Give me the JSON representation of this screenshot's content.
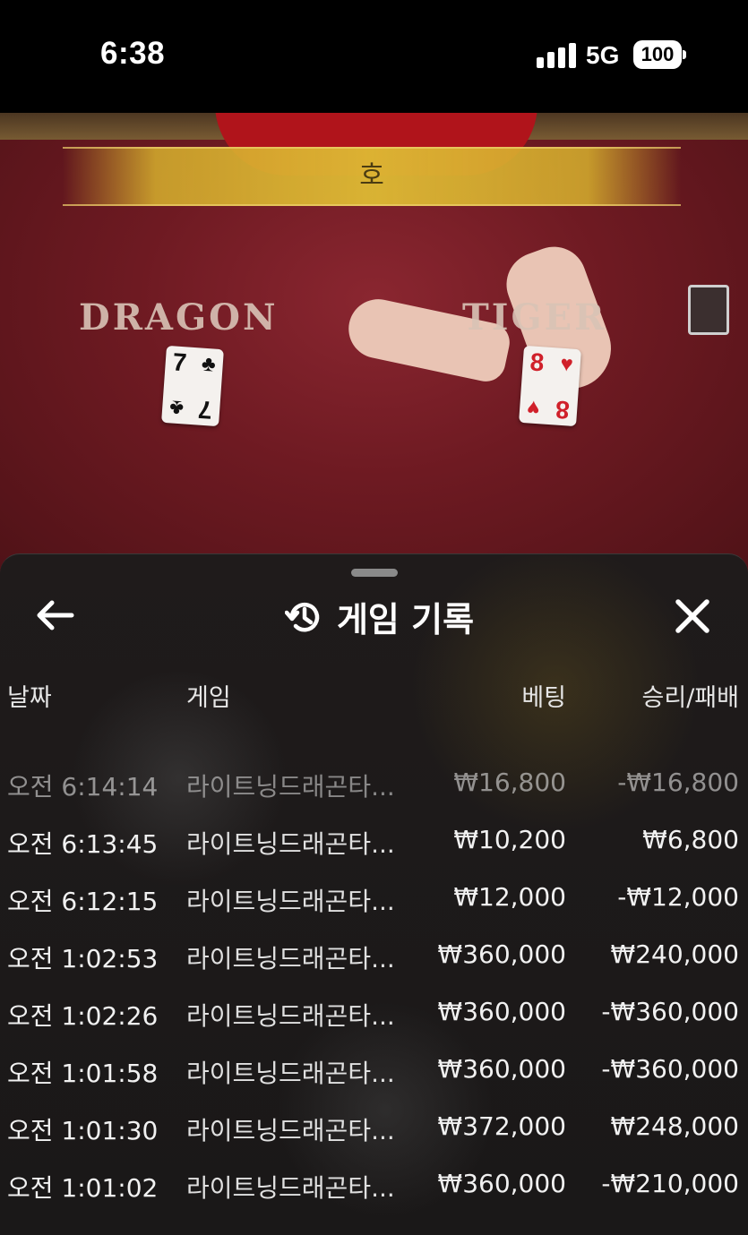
{
  "status_bar": {
    "time": "6:38",
    "network": "5G",
    "battery": "100"
  },
  "game_scene": {
    "result_banner": "호",
    "dragon_label": "DRAGON",
    "tiger_label": "TIGER",
    "dragon_card": {
      "rank": "7",
      "suit": "♣"
    },
    "tiger_card": {
      "rank": "8",
      "suit": "♥"
    }
  },
  "history": {
    "title": "게임 기록",
    "icons": {
      "back": "arrow-left-icon",
      "history": "history-icon",
      "close": "close-icon"
    },
    "columns": {
      "date": "날짜",
      "game": "게임",
      "bet": "베팅",
      "result": "승리/패배"
    },
    "rows": [
      {
        "date": "오전 6:14:14",
        "game": "라이트닝드래곤타...",
        "bet": "₩16,800",
        "result": "-₩16,800"
      },
      {
        "date": "오전 6:13:45",
        "game": "라이트닝드래곤타...",
        "bet": "₩10,200",
        "result": "₩6,800"
      },
      {
        "date": "오전 6:12:15",
        "game": "라이트닝드래곤타...",
        "bet": "₩12,000",
        "result": "-₩12,000"
      },
      {
        "date": "오전 1:02:53",
        "game": "라이트닝드래곤타...",
        "bet": "₩360,000",
        "result": "₩240,000"
      },
      {
        "date": "오전 1:02:26",
        "game": "라이트닝드래곤타...",
        "bet": "₩360,000",
        "result": "-₩360,000"
      },
      {
        "date": "오전 1:01:58",
        "game": "라이트닝드래곤타...",
        "bet": "₩360,000",
        "result": "-₩360,000"
      },
      {
        "date": "오전 1:01:30",
        "game": "라이트닝드래곤타...",
        "bet": "₩372,000",
        "result": "₩248,000"
      },
      {
        "date": "오전 1:01:02",
        "game": "라이트닝드래곤타...",
        "bet": "₩360,000",
        "result": "-₩210,000"
      }
    ]
  }
}
